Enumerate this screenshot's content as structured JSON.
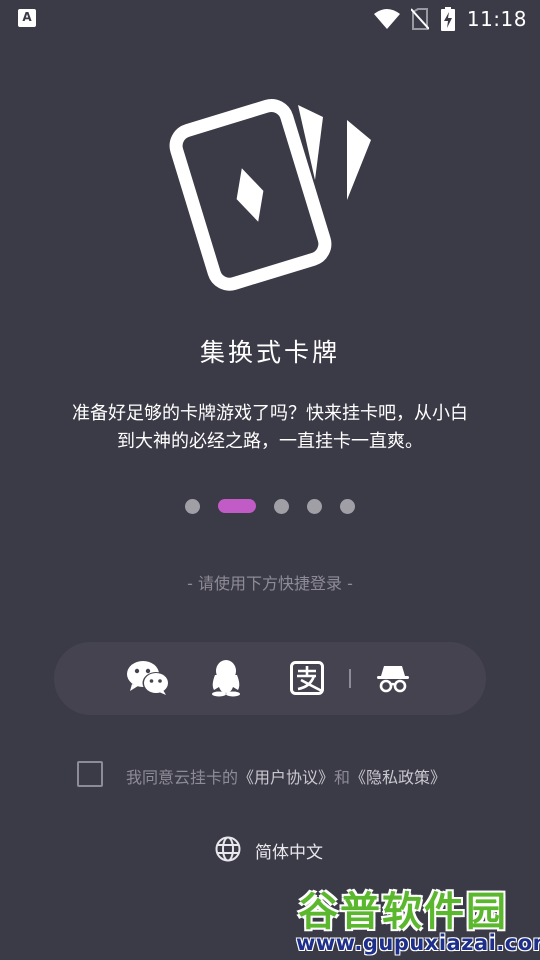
{
  "status_bar": {
    "time": "11:18",
    "left_icon_letter": "A",
    "icons": [
      "wifi-icon",
      "no-sim-icon",
      "battery-charging-icon"
    ]
  },
  "app": {
    "logo_icon": "playing-cards-icon",
    "title": "集换式卡牌",
    "description": "准备好足够的卡牌游戏了吗？快来挂卡吧，从小白到大神的必经之路，一直挂卡一直爽。"
  },
  "pager": {
    "count": 5,
    "active_index": 1
  },
  "login": {
    "hint": "- 请使用下方快捷登录 -",
    "methods": [
      {
        "name": "wechat",
        "icon": "wechat-icon"
      },
      {
        "name": "qq",
        "icon": "qq-penguin-icon"
      },
      {
        "name": "alipay",
        "icon": "alipay-icon"
      },
      {
        "name": "guest",
        "icon": "incognito-icon"
      }
    ]
  },
  "agreement": {
    "prefix": "我同意云挂卡的",
    "user_agreement": "《用户协议》",
    "conjunction": "和",
    "privacy_policy": "《隐私政策》",
    "checked": false
  },
  "language": {
    "icon": "globe-icon",
    "label": "简体中文"
  },
  "watermark": {
    "title": "谷普软件园",
    "url": "www.gupuxiazai.com"
  },
  "colors": {
    "background": "#3b3a47",
    "accent": "#c15bc6",
    "muted_text": "#8d8c96",
    "login_bar": "#44434f"
  }
}
